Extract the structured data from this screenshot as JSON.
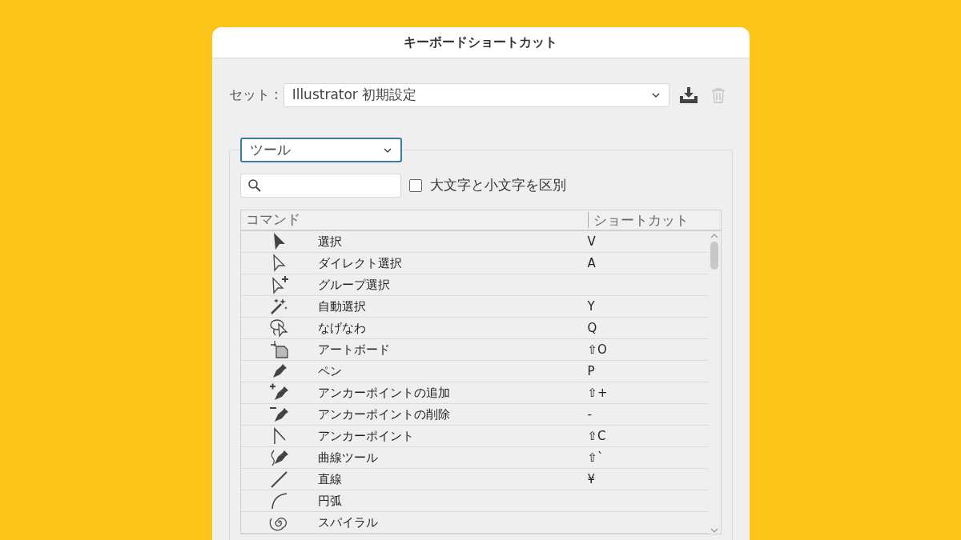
{
  "dialog": {
    "title": "キーボードショートカット"
  },
  "set": {
    "label": "セット :",
    "value": "Illustrator 初期設定"
  },
  "category": {
    "value": "ツール"
  },
  "case_sensitive": {
    "label": "大文字と小文字を区別",
    "checked": false
  },
  "table": {
    "columns": [
      "コマンド",
      "ショートカット"
    ],
    "rows": [
      {
        "kind": "select",
        "command": "選択",
        "shortcut": "V"
      },
      {
        "kind": "direct-select",
        "command": "ダイレクト選択",
        "shortcut": "A"
      },
      {
        "kind": "group-select",
        "command": "グループ選択"
      },
      {
        "kind": "magic-wand",
        "command": "自動選択",
        "shortcut": "Y"
      },
      {
        "kind": "lasso",
        "command": "なげなわ",
        "shortcut": "Q"
      },
      {
        "kind": "artboard",
        "command": "アートボード",
        "shortcut": "⇧O"
      },
      {
        "kind": "pen",
        "command": "ペン",
        "shortcut": "P"
      },
      {
        "kind": "add-anchor",
        "command": "アンカーポイントの追加",
        "shortcut": "⇧+"
      },
      {
        "kind": "delete-anchor",
        "command": "アンカーポイントの削除",
        "shortcut": "-"
      },
      {
        "kind": "anchor",
        "command": "アンカーポイント",
        "shortcut": "⇧C"
      },
      {
        "kind": "curvature",
        "command": "曲線ツール",
        "shortcut": "⇧`"
      },
      {
        "kind": "line",
        "command": "直線",
        "shortcut": "¥"
      },
      {
        "kind": "arc",
        "command": "円弧"
      },
      {
        "kind": "spiral",
        "command": "スパイラル"
      }
    ]
  }
}
